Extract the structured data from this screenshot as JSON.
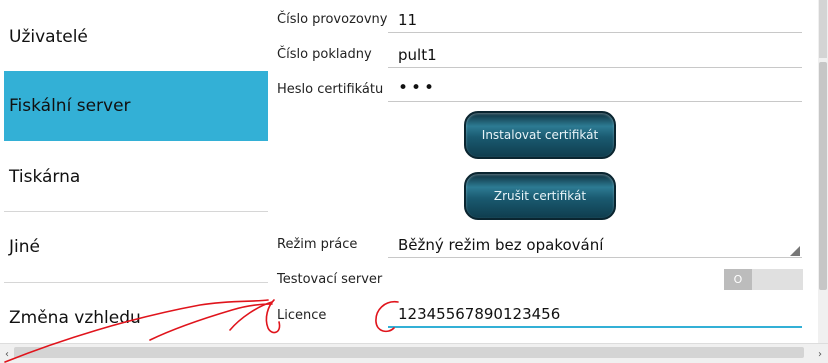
{
  "sidebar": {
    "items": [
      {
        "label": "Uživatelé",
        "active": false
      },
      {
        "label": "Fiskální server",
        "active": true
      },
      {
        "label": "Tiskárna",
        "active": false
      },
      {
        "label": "Jiné",
        "active": false
      },
      {
        "label": "Změna vzhledu",
        "active": false
      }
    ]
  },
  "form": {
    "provozovna": {
      "label": "Číslo provozovny",
      "value": "11"
    },
    "pokladna": {
      "label": "Číslo pokladny",
      "value": "pult1"
    },
    "heslo": {
      "label": "Heslo certifikátu",
      "value": "•••"
    },
    "install_button": "Instalovat certifikát",
    "cancel_button": "Zrušit certifikát",
    "rezim": {
      "label": "Režim práce",
      "value": "Běžný režim bez opakování"
    },
    "test_server": {
      "label": "Testovací server",
      "toggle_text": "O",
      "on": false
    },
    "licence": {
      "label": "Licence",
      "value": "12345567890123456"
    }
  },
  "colors": {
    "accent": "#33b0d6",
    "button_dark": "#0f3d4e",
    "annotation_ink": "#e0141c"
  }
}
